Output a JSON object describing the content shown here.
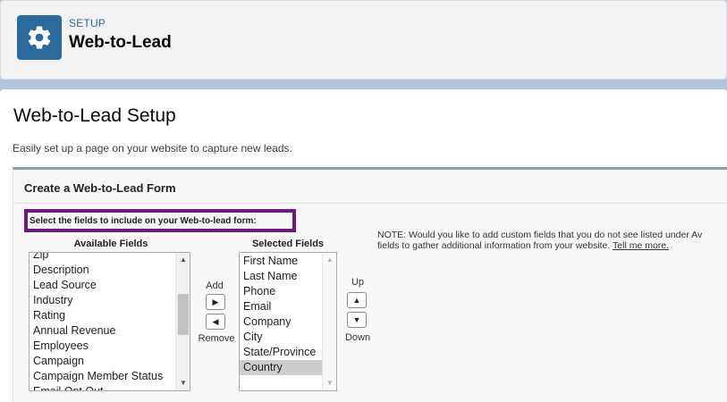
{
  "header": {
    "eyebrow": "SETUP",
    "title": "Web-to-Lead",
    "icon": "gear-icon"
  },
  "main": {
    "title": "Web-to-Lead Setup",
    "description": "Easily set up a page on your website to capture new leads."
  },
  "form_panel": {
    "title": "Create a Web-to-Lead Form",
    "select_label": "Select the fields to include on your Web-to-lead form:",
    "available_header": "Available Fields",
    "selected_header": "Selected Fields",
    "available_fields": [
      "Zip",
      "Description",
      "Lead Source",
      "Industry",
      "Rating",
      "Annual Revenue",
      "Employees",
      "Campaign",
      "Campaign Member Status",
      "Email Opt Out"
    ],
    "selected_fields": [
      "First Name",
      "Last Name",
      "Phone",
      "Email",
      "Company",
      "City",
      "State/Province",
      "Country"
    ],
    "selected_highlight": "Country",
    "add_label": "Add",
    "remove_label": "Remove",
    "up_label": "Up",
    "down_label": "Down",
    "note_text_line1": "NOTE: Would you like to add custom fields that you do not see listed under Av",
    "note_text_line2": "fields to gather additional information from your website.",
    "note_link": "Tell me more."
  },
  "colors": {
    "accent": "#2a6a9c",
    "highlight_border": "#6b1a7d",
    "background": "#b0c4df"
  }
}
